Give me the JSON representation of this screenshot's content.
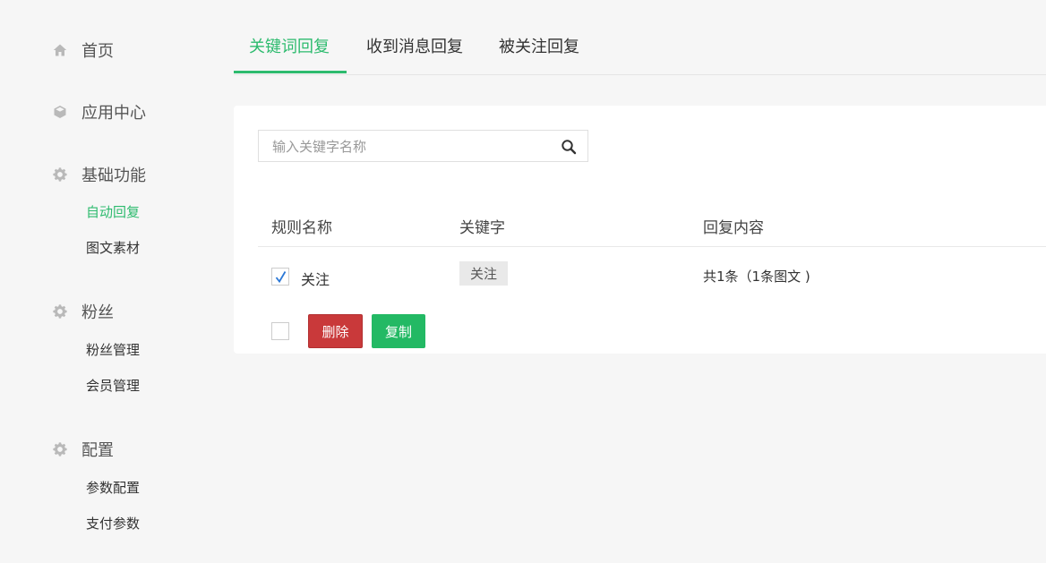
{
  "sidebar": {
    "home": {
      "label": "首页",
      "icon": "home-icon"
    },
    "app_center": {
      "label": "应用中心",
      "icon": "cube-icon"
    },
    "basic": {
      "label": "基础功能",
      "icon": "gear-icon",
      "items": [
        "自动回复",
        "图文素材"
      ]
    },
    "fans": {
      "label": "粉丝",
      "icon": "gear-icon",
      "items": [
        "粉丝管理",
        "会员管理"
      ]
    },
    "config": {
      "label": "配置",
      "icon": "gear-icon",
      "items": [
        "参数配置",
        "支付参数"
      ]
    }
  },
  "tabs": [
    "关键词回复",
    "收到消息回复",
    "被关注回复"
  ],
  "search": {
    "placeholder": "输入关键字名称",
    "value": ""
  },
  "table": {
    "headers": [
      "规则名称",
      "关键字",
      "回复内容"
    ],
    "rows": [
      {
        "checked": true,
        "name": "关注",
        "keyword": "关注",
        "reply": "共1条（1条图文 )"
      }
    ]
  },
  "actions": {
    "delete_label": "删除",
    "copy_label": "复制"
  },
  "colors": {
    "accent": "#2dbb6e",
    "danger": "#c9393a",
    "success": "#23b964",
    "background": "#f6f6f6"
  }
}
